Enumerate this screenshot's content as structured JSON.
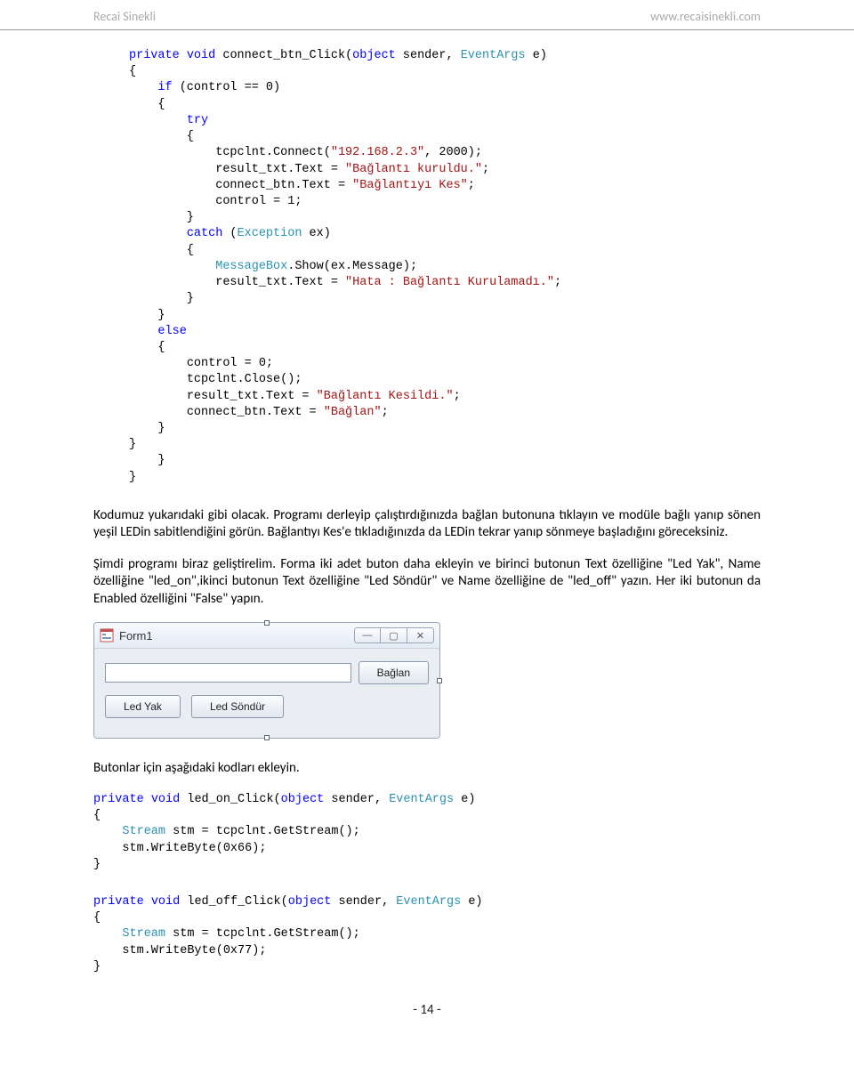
{
  "header": {
    "left": "Recai Sinekli",
    "right": "www.recaisinekli.com"
  },
  "code1": {
    "sig": [
      "private",
      "void",
      "connect_btn_Click(",
      "object",
      " sender, ",
      "EventArgs",
      " e)"
    ],
    "if_kw": "if",
    "if_cond": " (control == 0)",
    "try_kw": "try",
    "l1a": "tcpclnt.Connect(",
    "l1b": "\"192.168.2.3\"",
    "l1c": ", 2000);",
    "l2a": "result_txt.Text = ",
    "l2b": "\"Bağlantı kuruldu.\"",
    "l2c": ";",
    "l3a": "connect_btn.Text = ",
    "l3b": "\"Bağlantıyı Kes\"",
    "l3c": ";",
    "l4": "control = 1;",
    "catch_kw": "catch",
    "catch_paren_open": " (",
    "catch_typ": "Exception",
    "catch_paren_close": " ex)",
    "m1a": "MessageBox",
    "m1b": ".Show(ex.Message);",
    "m2a": "result_txt.Text = ",
    "m2b": "\"Hata : Bağlantı Kurulamadı.\"",
    "m2c": ";",
    "else_kw": "else",
    "e1": "control = 0;",
    "e2": "tcpclnt.Close();",
    "e3a": "result_txt.Text = ",
    "e3b": "\"Bağlantı Kesildi.\"",
    "e3c": ";",
    "e4a": "connect_btn.Text = ",
    "e4b": "\"Bağlan\"",
    "e4c": ";"
  },
  "para1": "Kodumuz yukarıdaki gibi olacak. Programı derleyip çalıştırdığınızda bağlan butonuna tıklayın ve modüle bağlı yanıp sönen yeşil LEDin sabitlendiğini görün. Bağlantıyı Kes'e tıkladığınızda da LEDin tekrar yanıp sönmeye başladığını göreceksiniz.",
  "para2": "Şimdi programı biraz geliştirelim. Forma iki adet buton daha ekleyin ve birinci butonun Text özelliğine \"Led Yak\", Name özelliğine \"led_on\",ikinci butonun Text özelliğine \"Led Söndür\" ve Name özelliğine de \"led_off\" yazın. Her iki butonun da Enabled özelliğini \"False\" yapın.",
  "form": {
    "title": "Form1",
    "connect_btn": "Bağlan",
    "led_on_btn": "Led Yak",
    "led_off_btn": "Led Söndür",
    "minimize": "—",
    "maximize": "▢",
    "close": "✕"
  },
  "para3": "Butonlar için aşağıdaki kodları ekleyin.",
  "code2": {
    "sig": [
      "private",
      "void",
      "led_on_Click(",
      "object",
      " sender, ",
      "EventArgs",
      " e)"
    ],
    "l1a": "Stream",
    "l1b": " stm = tcpclnt.GetStream();",
    "l2": "stm.WriteByte(0x66);"
  },
  "code3": {
    "sig": [
      "private",
      "void",
      "led_off_Click(",
      "object",
      " sender, ",
      "EventArgs",
      " e)"
    ],
    "l1a": "Stream",
    "l1b": " stm = tcpclnt.GetStream();",
    "l2": "stm.WriteByte(0x77);"
  },
  "footer": "- 14 -"
}
